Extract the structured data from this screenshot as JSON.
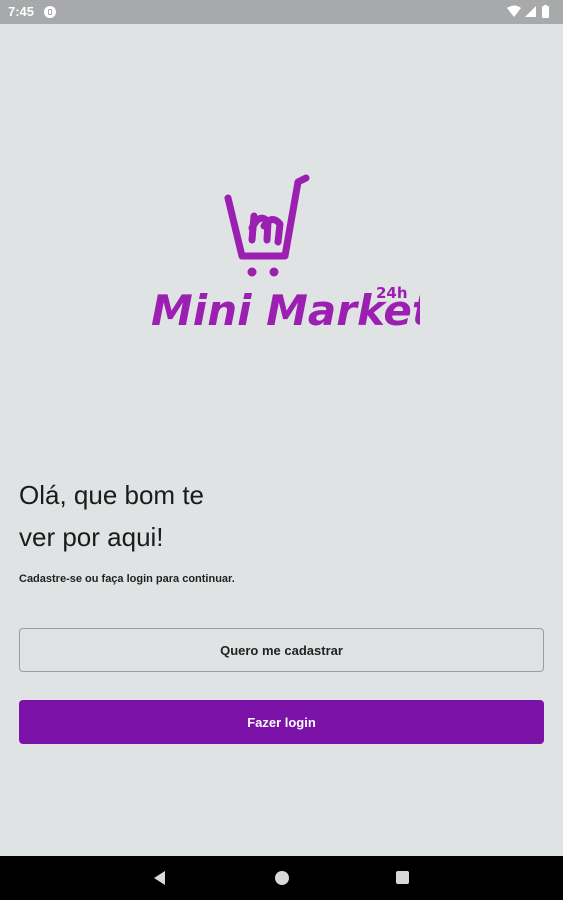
{
  "status_bar": {
    "time": "7:45",
    "icons": [
      "app-notification-icon",
      "wifi-icon",
      "signal-icon",
      "battery-icon"
    ]
  },
  "logo": {
    "brand_name": "Mini Market",
    "superscript": "24h",
    "brand_color": "#9b1fb1"
  },
  "welcome": {
    "headline_line1": "Olá, que bom te",
    "headline_line2": "ver por aqui!",
    "subtitle": "Cadastre-se ou faça login para continuar."
  },
  "actions": {
    "register_label": "Quero me cadastrar",
    "login_label": "Fazer login",
    "primary_color": "#7b12a8"
  },
  "nav_bar": {
    "icons": [
      "back-icon",
      "home-icon",
      "recents-icon"
    ]
  }
}
